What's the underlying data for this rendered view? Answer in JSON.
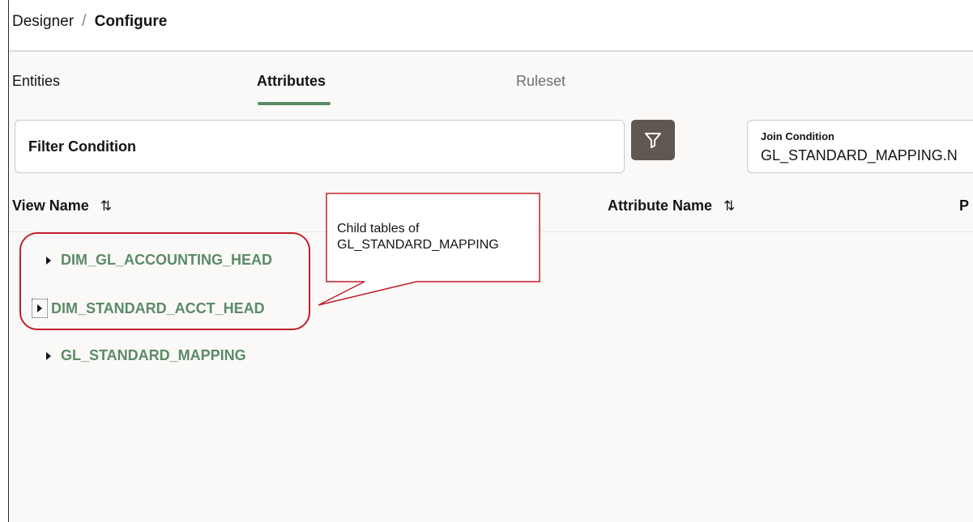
{
  "breadcrumb": {
    "parent": "Designer",
    "separator": "/",
    "current": "Configure"
  },
  "tabs": [
    {
      "label": "Entities",
      "selected": false
    },
    {
      "label": "Attributes",
      "selected": true
    },
    {
      "label": "Ruleset",
      "selected": false
    }
  ],
  "filter": {
    "label": "Filter Condition",
    "button_icon": "filter-icon"
  },
  "join": {
    "label": "Join Condition",
    "value": "GL_STANDARD_MAPPING.N"
  },
  "table": {
    "columns": [
      {
        "label": "View Name",
        "sort_icon": "⇅"
      },
      {
        "label": "Attribute Name",
        "sort_icon": "⇅"
      },
      {
        "label": "P"
      }
    ],
    "rows": [
      {
        "label": "DIM_GL_ACCOUNTING_HEAD",
        "expanded": false
      },
      {
        "label": "DIM_STANDARD_ACCT_HEAD",
        "expanded": false,
        "focused": true
      },
      {
        "label": "GL_STANDARD_MAPPING",
        "expanded": false
      }
    ]
  },
  "callout": {
    "line1": "Child tables of",
    "line2": "GL_STANDARD_MAPPING"
  },
  "colors": {
    "accent": "#5a8b67",
    "filter_button": "#615751",
    "callout_border": "#c0202a"
  }
}
